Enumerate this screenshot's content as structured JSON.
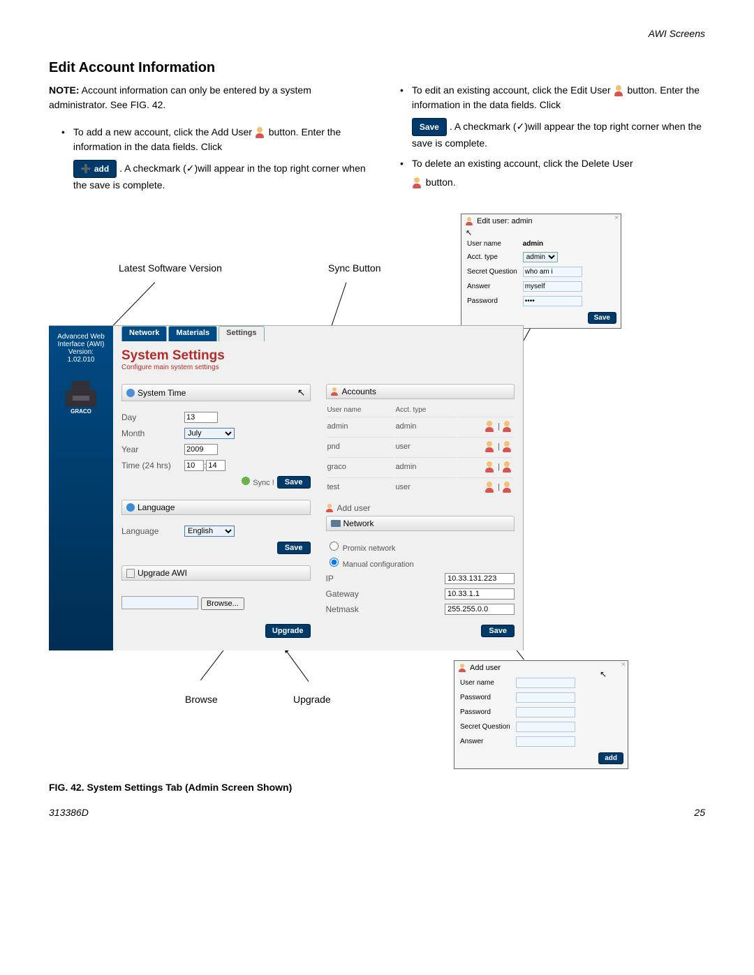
{
  "header": {
    "section": "AWI Screens"
  },
  "title": "Edit Account Information",
  "note_label": "NOTE:",
  "note_text": " Account information can only be entered by a system administrator. See FIG. 42.",
  "left_bullet": {
    "l1": "To add a new account, click the Add User ",
    "l2": " button. Enter the information in the data fields. Click ",
    "l3": ". A checkmark (✓)will appear in the top right corner when the save is complete."
  },
  "right_bullet1": {
    "l1": "To edit an existing account, click the Edit User ",
    "l2": "button. Enter the information in the data fields. Click ",
    "l3": ". A checkmark (✓)will appear the top right corner when the save is complete."
  },
  "right_bullet2": {
    "l1": "To delete an existing account, click the Delete User ",
    "l2": " button."
  },
  "btn_add": "add",
  "btn_save": "Save",
  "callouts": {
    "version": "Latest Software Version",
    "sync": "Sync Button",
    "browse": "Browse",
    "upgrade": "Upgrade"
  },
  "popup_edit": {
    "title": "Edit user: admin",
    "fields": {
      "username_l": "User name",
      "username_v": "admin",
      "accttype_l": "Acct. type",
      "accttype_v": "admin",
      "sq_l": "Secret Question",
      "sq_v": "who am i",
      "ans_l": "Answer",
      "ans_v": "myself",
      "pw_l": "Password",
      "pw_v": "••••"
    },
    "save": "Save"
  },
  "popup_add": {
    "title": "Add user",
    "fields": {
      "username": "User name",
      "password1": "Password",
      "password2": "Password",
      "sq": "Secret Question",
      "ans": "Answer"
    },
    "add": "add"
  },
  "awi": {
    "side_lines": {
      "l1": "Advanced Web",
      "l2": "Interface (AWI)",
      "l3": "Version:",
      "l4": "1.02.010"
    },
    "tabs": {
      "network": "Network",
      "materials": "Materials",
      "settings": "Settings"
    },
    "title": "System Settings",
    "subtitle": "Configure main system settings",
    "time_panel": {
      "head": "System Time",
      "day_l": "Day",
      "day_v": "13",
      "month_l": "Month",
      "month_v": "July",
      "year_l": "Year",
      "year_v": "2009",
      "time_l": "Time (24 hrs)",
      "h": "10",
      "m": "14",
      "sync": "Sync !",
      "save": "Save"
    },
    "lang_panel": {
      "head": "Language",
      "lang_l": "Language",
      "lang_v": "English",
      "save": "Save"
    },
    "upgrade_panel": {
      "head": "Upgrade AWI",
      "browse": "Browse...",
      "upgrade": "Upgrade"
    },
    "accounts_panel": {
      "head": "Accounts",
      "col1": "User name",
      "col2": "Acct. type",
      "rows": [
        {
          "u": "admin",
          "t": "admin"
        },
        {
          "u": "pnd",
          "t": "user"
        },
        {
          "u": "graco",
          "t": "admin"
        },
        {
          "u": "test",
          "t": "user"
        }
      ],
      "add": "Add user"
    },
    "network_panel": {
      "head": "Network",
      "r1": "Promix network",
      "r2": "Manual configuration",
      "ip_l": "IP",
      "ip_v": "10.33.131.223",
      "gw_l": "Gateway",
      "gw_v": "10.33.1.1",
      "nm_l": "Netmask",
      "nm_v": "255.255.0.0",
      "save": "Save"
    }
  },
  "caption": "FIG. 42. System Settings Tab (Admin Screen Shown)",
  "footer": {
    "doc": "313386D",
    "page": "25"
  }
}
